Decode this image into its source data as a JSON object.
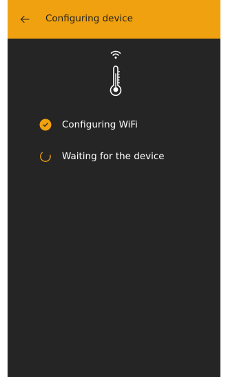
{
  "header": {
    "title": "Configuring device",
    "back_icon": "arrow-left-icon"
  },
  "device": {
    "signal_icon": "wifi-icon",
    "device_icon": "thermometer-icon"
  },
  "steps": [
    {
      "label": "Configuring WiFi",
      "status": "done",
      "icon": "check-circle-icon"
    },
    {
      "label": "Waiting for the device",
      "status": "in-progress",
      "icon": "spinner-icon"
    }
  ],
  "colors": {
    "accent": "#f0a10f",
    "background": "#252525",
    "text": "#ffffff",
    "header_text": "#1f1f1f"
  }
}
